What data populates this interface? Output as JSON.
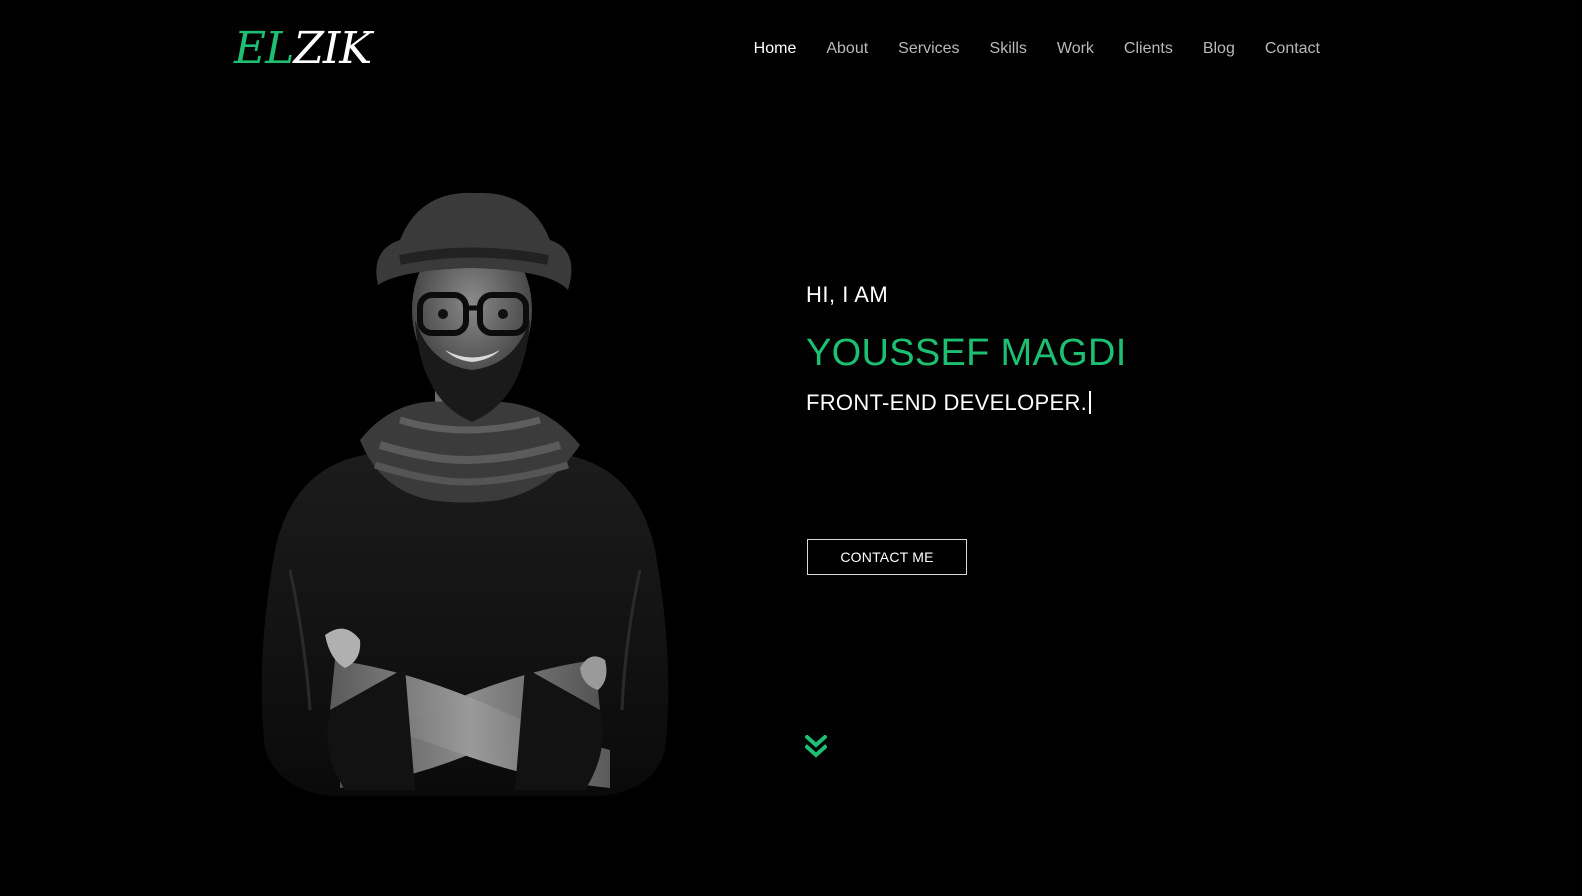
{
  "header": {
    "logo": {
      "part_green": "EL",
      "part_white": "ZIK"
    },
    "nav": [
      {
        "label": "Home",
        "active": true
      },
      {
        "label": "About",
        "active": false
      },
      {
        "label": "Services",
        "active": false
      },
      {
        "label": "Skills",
        "active": false
      },
      {
        "label": "Work",
        "active": false
      },
      {
        "label": "Clients",
        "active": false
      },
      {
        "label": "Blog",
        "active": false
      },
      {
        "label": "Contact",
        "active": false
      }
    ]
  },
  "hero": {
    "greeting": "HI, I AM",
    "name": "YOUSSEF MAGDI",
    "role": "FRONT-END DEVELOPER.",
    "cta_label": "CONTACT ME",
    "portrait_icon": "person-portrait-photo",
    "scroll_icon": "double-chevron-down-icon"
  },
  "colors": {
    "background": "#000000",
    "accent": "#1dbf73",
    "text": "#ffffff",
    "nav_text": "#b9b9b9"
  }
}
